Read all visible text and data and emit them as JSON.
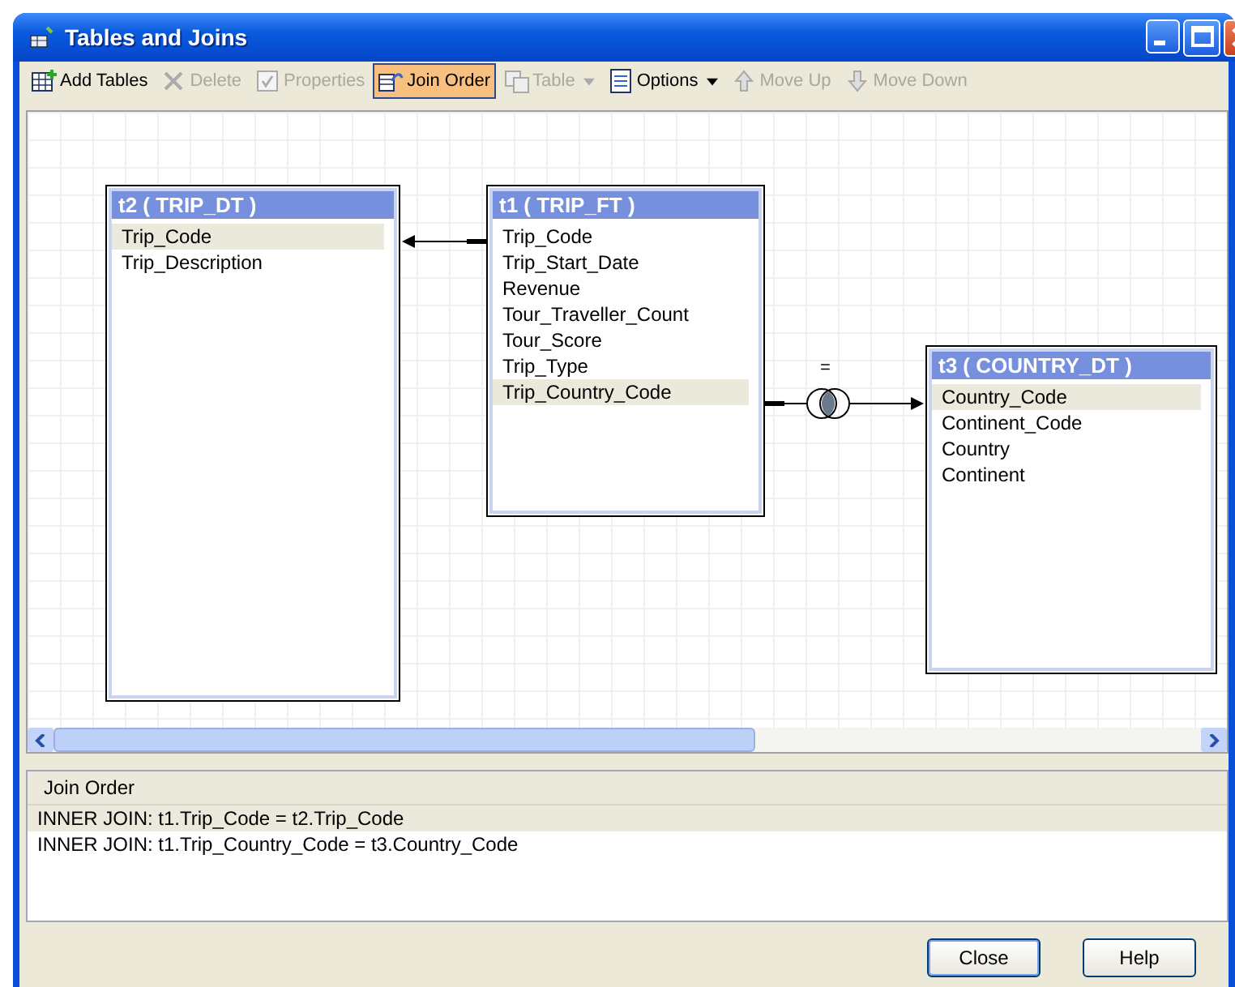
{
  "window": {
    "title": "Tables and Joins"
  },
  "toolbar": [
    {
      "label": "Add Tables",
      "kind": "button",
      "disabled": false,
      "selected": false
    },
    {
      "label": "Delete",
      "kind": "button",
      "disabled": true,
      "selected": false
    },
    {
      "label": "Properties",
      "kind": "button",
      "disabled": true,
      "selected": false
    },
    {
      "label": "Join Order",
      "kind": "button",
      "disabled": false,
      "selected": true
    },
    {
      "label": "Table",
      "kind": "dropdown",
      "disabled": true,
      "selected": false
    },
    {
      "label": "Options",
      "kind": "dropdown",
      "disabled": false,
      "selected": false
    },
    {
      "label": "Move Up",
      "kind": "button",
      "disabled": true,
      "selected": false
    },
    {
      "label": "Move Down",
      "kind": "button",
      "disabled": true,
      "selected": false
    }
  ],
  "tables": [
    {
      "title": "t2 ( TRIP_DT )",
      "fields": [
        {
          "name": "Trip_Code",
          "selected": true
        },
        {
          "name": "Trip_Description",
          "selected": false
        }
      ]
    },
    {
      "title": "t1 ( TRIP_FT )",
      "fields": [
        {
          "name": "Trip_Code",
          "selected": false
        },
        {
          "name": "Trip_Start_Date",
          "selected": false
        },
        {
          "name": "Revenue",
          "selected": false
        },
        {
          "name": "Tour_Traveller_Count",
          "selected": false
        },
        {
          "name": "Tour_Score",
          "selected": false
        },
        {
          "name": "Trip_Type",
          "selected": false
        },
        {
          "name": "Trip_Country_Code",
          "selected": true
        }
      ]
    },
    {
      "title": "t3 ( COUNTRY_DT )",
      "fields": [
        {
          "name": "Country_Code",
          "selected": true
        },
        {
          "name": "Continent_Code",
          "selected": false
        },
        {
          "name": "Country",
          "selected": false
        },
        {
          "name": "Continent",
          "selected": false
        }
      ]
    }
  ],
  "joins": [
    {
      "operator": "="
    }
  ],
  "join_order": {
    "title": "Join Order",
    "rows": [
      {
        "text": "INNER JOIN: t1.Trip_Code = t2.Trip_Code",
        "selected": true
      },
      {
        "text": "INNER JOIN: t1.Trip_Country_Code = t3.Country_Code",
        "selected": false
      }
    ]
  },
  "buttons": [
    "Close",
    "Help"
  ]
}
